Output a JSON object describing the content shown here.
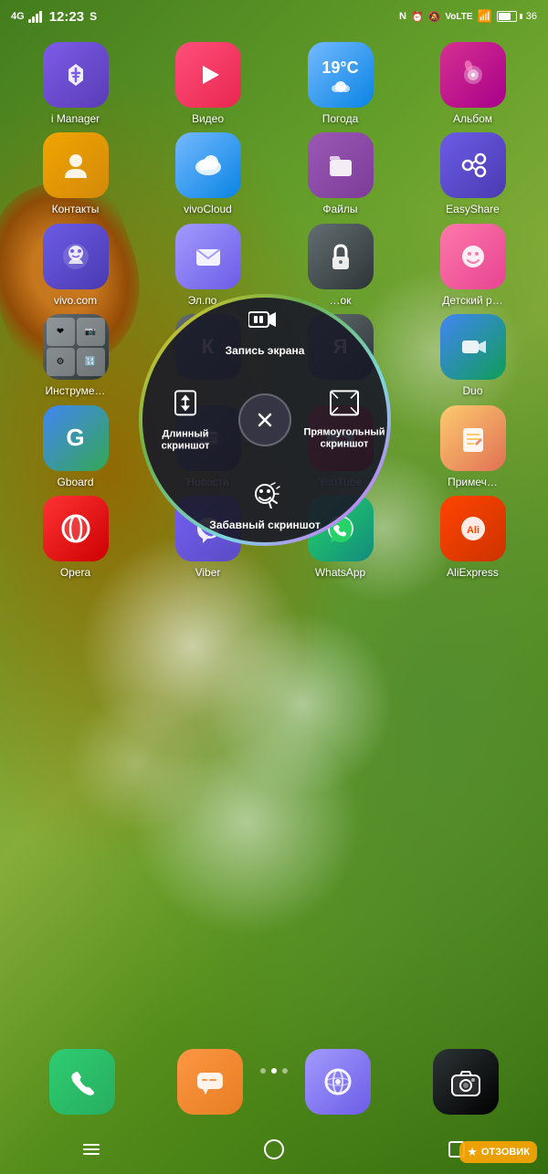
{
  "statusBar": {
    "time": "12:23",
    "signal": "4G",
    "battery": "36",
    "icons": [
      "N",
      "⏰",
      "🔕",
      "VoLTE",
      "WiFi"
    ]
  },
  "apps": {
    "row1": [
      {
        "id": "imanager",
        "label": "i Manager",
        "class": "app-imanager",
        "icon": "🛡️"
      },
      {
        "id": "video",
        "label": "Видео",
        "class": "app-video",
        "icon": "▶"
      },
      {
        "id": "weather",
        "label": "Погода",
        "class": "app-weather",
        "icon": "19°C"
      },
      {
        "id": "album",
        "label": "Альбом",
        "class": "app-album",
        "icon": "🖼"
      }
    ],
    "row2": [
      {
        "id": "contacts",
        "label": "Контакты",
        "class": "app-contacts",
        "icon": "👤"
      },
      {
        "id": "vivocloud",
        "label": "vivoCloud",
        "class": "app-vivocloud",
        "icon": "☁️"
      },
      {
        "id": "files",
        "label": "Файлы",
        "class": "app-files",
        "icon": "📁"
      },
      {
        "id": "easyshare",
        "label": "EasyShare",
        "class": "app-easyshare",
        "icon": "🔗"
      }
    ],
    "row3": [
      {
        "id": "vivocom",
        "label": "vivo.com",
        "class": "app-vivocom",
        "icon": "🤖"
      },
      {
        "id": "email",
        "label": "Эл.по…",
        "class": "app-email",
        "icon": "✉️"
      },
      {
        "id": "lock",
        "label": "…ок",
        "class": "app-lock",
        "icon": "🔒"
      },
      {
        "id": "kids",
        "label": "Детский р…",
        "class": "app-kids",
        "icon": "😊"
      }
    ],
    "row4": [
      {
        "id": "tools",
        "label": "Инструме…",
        "class": "app-tools",
        "icon": "🔧"
      },
      {
        "id": "keyboard",
        "label": "К",
        "class": "app-keyboard",
        "icon": "⌨"
      },
      {
        "id": "rec",
        "label": "Я",
        "class": "app-rec",
        "icon": "📱"
      },
      {
        "id": "duo",
        "label": "Duo",
        "class": "app-duo",
        "icon": "📹"
      }
    ],
    "row5": [
      {
        "id": "gboard",
        "label": "Gboard",
        "class": "app-gboard",
        "icon": "G"
      },
      {
        "id": "news",
        "label": "Новости",
        "class": "app-news",
        "icon": "📰"
      },
      {
        "id": "youtube",
        "label": "YouTube",
        "class": "app-youtube",
        "icon": "▶"
      },
      {
        "id": "notes",
        "label": "Примеч…",
        "class": "app-notes",
        "icon": "✏️"
      }
    ],
    "row6": [
      {
        "id": "opera",
        "label": "Opera",
        "class": "app-opera",
        "icon": "O"
      },
      {
        "id": "viber",
        "label": "Viber",
        "class": "app-viber",
        "icon": "📞"
      },
      {
        "id": "whatsapp",
        "label": "WhatsApp",
        "class": "app-whatsapp",
        "icon": "💬"
      },
      {
        "id": "aliexpress",
        "label": "AliExpress",
        "class": "app-aliexpress",
        "icon": "🛒"
      }
    ],
    "dock": [
      {
        "id": "phone",
        "label": "",
        "class": "app-phone",
        "icon": "📞"
      },
      {
        "id": "messages",
        "label": "",
        "class": "app-messages",
        "icon": "💬"
      },
      {
        "id": "jovi",
        "label": "",
        "class": "app-jovi",
        "icon": "🪐"
      },
      {
        "id": "camera",
        "label": "",
        "class": "app-camera",
        "icon": "📷"
      }
    ]
  },
  "screenshotMenu": {
    "top": {
      "icon": "⏸📹",
      "label": "Запись экрана"
    },
    "left": {
      "icon": "⬍",
      "label": "Длинный скриншот"
    },
    "right": {
      "icon": "⤢",
      "label": "Прямоугольный скриншот"
    },
    "bottom": {
      "icon": "✂",
      "label": "Забавный скриншот"
    },
    "center": "✕"
  },
  "navigation": {
    "back": "☰",
    "home": "⌂",
    "recents": "◻"
  },
  "watermark": {
    "text": "ОТЗОВИК",
    "icon": "★"
  }
}
